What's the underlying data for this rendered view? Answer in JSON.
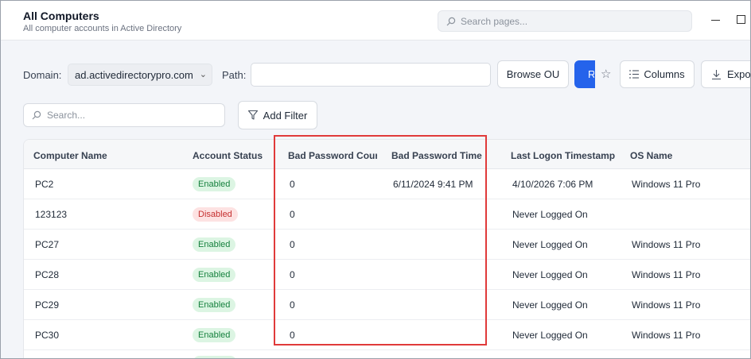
{
  "header": {
    "title": "All Computers",
    "subtitle": "All computer accounts in Active Directory",
    "search_placeholder": "Search pages..."
  },
  "toolbar": {
    "domain_label": "Domain:",
    "domain_value": "ad.activedirectorypro.com",
    "path_label": "Path:",
    "path_value": "",
    "browse_label": "Browse OU",
    "run_label": "R",
    "columns_label": "Columns",
    "export_label": "Expor"
  },
  "filters": {
    "search_placeholder": "Search...",
    "add_filter_label": "Add Filter"
  },
  "table": {
    "columns": [
      "Computer Name",
      "Account Status",
      "Bad Password Coun",
      "Bad Password Time",
      "Last Logon Timestamp",
      "OS Name"
    ],
    "rows": [
      {
        "name": "PC2",
        "status": "Enabled",
        "bad_count": "0",
        "bad_time": "6/11/2024 9:41 PM",
        "last_logon": "4/10/2026 7:06 PM",
        "os": "Windows 11 Pro"
      },
      {
        "name": "123123",
        "status": "Disabled",
        "bad_count": "0",
        "bad_time": "",
        "last_logon": "Never Logged On",
        "os": ""
      },
      {
        "name": "PC27",
        "status": "Enabled",
        "bad_count": "0",
        "bad_time": "",
        "last_logon": "Never Logged On",
        "os": "Windows 11 Pro"
      },
      {
        "name": "PC28",
        "status": "Enabled",
        "bad_count": "0",
        "bad_time": "",
        "last_logon": "Never Logged On",
        "os": "Windows 11 Pro"
      },
      {
        "name": "PC29",
        "status": "Enabled",
        "bad_count": "0",
        "bad_time": "",
        "last_logon": "Never Logged On",
        "os": "Windows 11 Pro"
      },
      {
        "name": "PC30",
        "status": "Enabled",
        "bad_count": "0",
        "bad_time": "",
        "last_logon": "Never Logged On",
        "os": "Windows 11 Pro"
      }
    ]
  },
  "colors": {
    "accent": "#2563eb",
    "highlight": "#e03a3a",
    "enabled_bg": "#dcf5e3",
    "disabled_bg": "#fde2e2"
  },
  "icons": {
    "page_search": "search-icon",
    "star": "star-icon",
    "columns": "columns-icon",
    "export": "download-icon",
    "filter": "filter-icon"
  }
}
